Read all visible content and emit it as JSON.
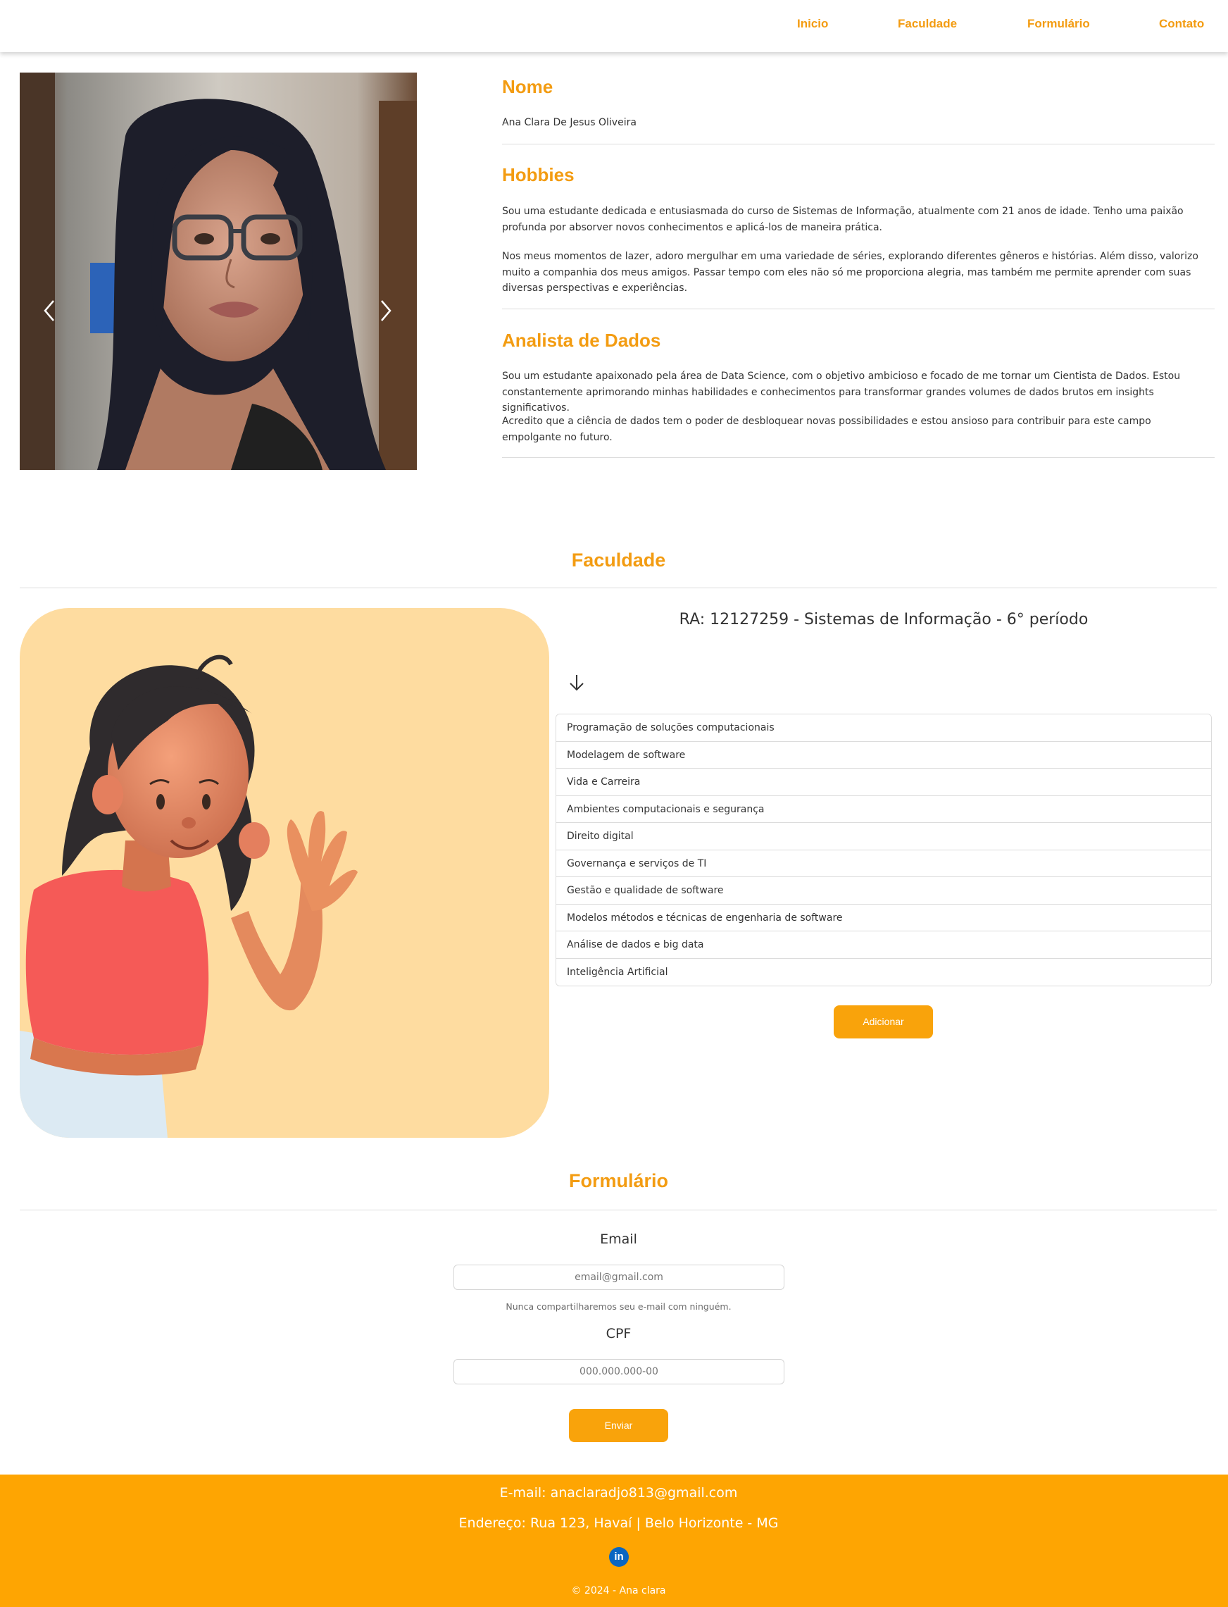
{
  "nav": {
    "items": [
      {
        "label": "Inicio"
      },
      {
        "label": "Faculdade"
      },
      {
        "label": "Formulário"
      },
      {
        "label": "Contato"
      }
    ]
  },
  "profile": {
    "nome_title": "Nome",
    "nome_value": "Ana Clara De Jesus Oliveira",
    "hobbies_title": "Hobbies",
    "hobbies_p1": "Sou uma estudante dedicada e entusiasmada do curso de Sistemas de Informação, atualmente com 21 anos de idade. Tenho uma paixão profunda por absorver novos conhecimentos e aplicá-los de maneira prática.",
    "hobbies_p2": "Nos meus momentos de lazer, adoro mergulhar em uma variedade de séries, explorando diferentes gêneros e histórias. Além disso, valorizo muito a companhia dos meus amigos. Passar tempo com eles não só me proporciona alegria, mas também me permite aprender com suas diversas perspectivas e experiências.",
    "analista_title": "Analista de Dados",
    "analista_p1": "Sou um estudante apaixonado pela área de Data Science, com o objetivo ambicioso e focado de me tornar um Cientista de Dados. Estou constantemente aprimorando minhas habilidades e conhecimentos para transformar grandes volumes de dados brutos em insights significativos.",
    "analista_p2": "Acredito que a ciência de dados tem o poder de desbloquear novas possibilidades e estou ansioso para contribuir para este campo empolgante no futuro."
  },
  "faculdade": {
    "title": "Faculdade",
    "ra": "RA: 12127259 - Sistemas de Informação - 6° período",
    "subjects": [
      "Programação de soluções computacionais",
      "Modelagem de software",
      "Vida e Carreira",
      "Ambientes computacionais e segurança",
      "Direito digital",
      "Governança e serviços de TI",
      "Gestão e qualidade de software",
      "Modelos métodos e técnicas de engenharia de software",
      "Análise de dados e big data",
      "Inteligência Artificial"
    ],
    "add_button": "Adicionar"
  },
  "form": {
    "title": "Formulário",
    "email_label": "Email",
    "email_placeholder": "email@gmail.com",
    "email_help": "Nunca compartilharemos seu e-mail com ninguém.",
    "cpf_label": "CPF",
    "cpf_placeholder": "000.000.000-00",
    "submit": "Enviar"
  },
  "footer": {
    "email": "E-mail: anaclaradjo813@gmail.com",
    "address": "Endereço: Rua 123, Havaí | Belo Horizonte - MG",
    "copyright": "© 2024 - Ana clara"
  },
  "colors": {
    "accent": "#f39c12",
    "button": "#f9a30b",
    "footer": "#fea502",
    "avatar_bg": "#fedca0",
    "linkedin": "#0a66c2"
  },
  "icons": {
    "carousel_prev": "chevron-left-icon",
    "carousel_next": "chevron-right-icon",
    "arrow_down": "arrow-down-icon",
    "linkedin": "linkedin-icon"
  }
}
